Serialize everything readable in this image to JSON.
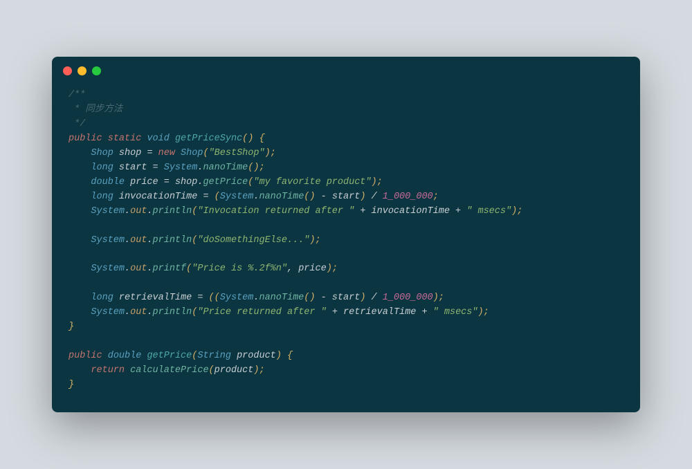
{
  "window": {
    "dots": [
      "red",
      "yellow",
      "green"
    ]
  },
  "code": {
    "lines": [
      {
        "indent": 0,
        "tokens": [
          {
            "c": "c-comment",
            "t": "/**"
          }
        ]
      },
      {
        "indent": 0,
        "tokens": [
          {
            "c": "c-comment",
            "t": " * 同步方法"
          }
        ]
      },
      {
        "indent": 0,
        "tokens": [
          {
            "c": "c-comment",
            "t": " */"
          }
        ]
      },
      {
        "indent": 0,
        "tokens": [
          {
            "c": "c-kw",
            "t": "public "
          },
          {
            "c": "c-kw",
            "t": "static "
          },
          {
            "c": "c-type",
            "t": "void "
          },
          {
            "c": "c-method",
            "t": "getPriceSync"
          },
          {
            "c": "c-paren",
            "t": "() {"
          }
        ]
      },
      {
        "indent": 1,
        "tokens": [
          {
            "c": "c-type",
            "t": "Shop "
          },
          {
            "c": "c-ident",
            "t": "shop "
          },
          {
            "c": "c-op",
            "t": "= "
          },
          {
            "c": "c-kw",
            "t": "new "
          },
          {
            "c": "c-type",
            "t": "Shop"
          },
          {
            "c": "c-paren",
            "t": "("
          },
          {
            "c": "c-string",
            "t": "\"BestShop\""
          },
          {
            "c": "c-paren",
            "t": ");"
          }
        ]
      },
      {
        "indent": 1,
        "tokens": [
          {
            "c": "c-type",
            "t": "long "
          },
          {
            "c": "c-ident",
            "t": "start "
          },
          {
            "c": "c-op",
            "t": "= "
          },
          {
            "c": "c-type",
            "t": "System"
          },
          {
            "c": "c-op",
            "t": "."
          },
          {
            "c": "c-call",
            "t": "nanoTime"
          },
          {
            "c": "c-paren",
            "t": "();"
          }
        ]
      },
      {
        "indent": 1,
        "tokens": [
          {
            "c": "c-type",
            "t": "double "
          },
          {
            "c": "c-ident",
            "t": "price "
          },
          {
            "c": "c-op",
            "t": "= "
          },
          {
            "c": "c-ident",
            "t": "shop"
          },
          {
            "c": "c-op",
            "t": "."
          },
          {
            "c": "c-call",
            "t": "getPrice"
          },
          {
            "c": "c-paren",
            "t": "("
          },
          {
            "c": "c-string",
            "t": "\"my favorite product\""
          },
          {
            "c": "c-paren",
            "t": ");"
          }
        ]
      },
      {
        "indent": 1,
        "tokens": [
          {
            "c": "c-type",
            "t": "long "
          },
          {
            "c": "c-ident",
            "t": "invocationTime "
          },
          {
            "c": "c-op",
            "t": "= "
          },
          {
            "c": "c-paren",
            "t": "("
          },
          {
            "c": "c-type",
            "t": "System"
          },
          {
            "c": "c-op",
            "t": "."
          },
          {
            "c": "c-call",
            "t": "nanoTime"
          },
          {
            "c": "c-paren",
            "t": "()"
          },
          {
            "c": "c-op",
            "t": " - "
          },
          {
            "c": "c-ident",
            "t": "start"
          },
          {
            "c": "c-paren",
            "t": ")"
          },
          {
            "c": "c-op",
            "t": " / "
          },
          {
            "c": "c-number",
            "t": "1_000_000"
          },
          {
            "c": "c-paren",
            "t": ";"
          }
        ]
      },
      {
        "indent": 1,
        "tokens": [
          {
            "c": "c-type",
            "t": "System"
          },
          {
            "c": "c-op",
            "t": "."
          },
          {
            "c": "c-field",
            "t": "out"
          },
          {
            "c": "c-op",
            "t": "."
          },
          {
            "c": "c-call",
            "t": "println"
          },
          {
            "c": "c-paren",
            "t": "("
          },
          {
            "c": "c-string",
            "t": "\"Invocation returned after \""
          },
          {
            "c": "c-op",
            "t": " + "
          },
          {
            "c": "c-ident",
            "t": "invocationTime"
          },
          {
            "c": "c-op",
            "t": " + "
          },
          {
            "c": "c-string",
            "t": "\" msecs\""
          },
          {
            "c": "c-paren",
            "t": ");"
          }
        ]
      },
      {
        "indent": 0,
        "tokens": [
          {
            "c": "c-ident",
            "t": ""
          }
        ]
      },
      {
        "indent": 1,
        "tokens": [
          {
            "c": "c-type",
            "t": "System"
          },
          {
            "c": "c-op",
            "t": "."
          },
          {
            "c": "c-field",
            "t": "out"
          },
          {
            "c": "c-op",
            "t": "."
          },
          {
            "c": "c-call",
            "t": "println"
          },
          {
            "c": "c-paren",
            "t": "("
          },
          {
            "c": "c-string",
            "t": "\"doSomethingElse...\""
          },
          {
            "c": "c-paren",
            "t": ");"
          }
        ]
      },
      {
        "indent": 0,
        "tokens": [
          {
            "c": "c-ident",
            "t": ""
          }
        ]
      },
      {
        "indent": 1,
        "tokens": [
          {
            "c": "c-type",
            "t": "System"
          },
          {
            "c": "c-op",
            "t": "."
          },
          {
            "c": "c-field",
            "t": "out"
          },
          {
            "c": "c-op",
            "t": "."
          },
          {
            "c": "c-call",
            "t": "printf"
          },
          {
            "c": "c-paren",
            "t": "("
          },
          {
            "c": "c-string",
            "t": "\"Price is %.2f%n\""
          },
          {
            "c": "c-op",
            "t": ", "
          },
          {
            "c": "c-ident",
            "t": "price"
          },
          {
            "c": "c-paren",
            "t": ");"
          }
        ]
      },
      {
        "indent": 0,
        "tokens": [
          {
            "c": "c-ident",
            "t": ""
          }
        ]
      },
      {
        "indent": 1,
        "tokens": [
          {
            "c": "c-type",
            "t": "long "
          },
          {
            "c": "c-ident",
            "t": "retrievalTime "
          },
          {
            "c": "c-op",
            "t": "= "
          },
          {
            "c": "c-paren",
            "t": "(("
          },
          {
            "c": "c-type",
            "t": "System"
          },
          {
            "c": "c-op",
            "t": "."
          },
          {
            "c": "c-call",
            "t": "nanoTime"
          },
          {
            "c": "c-paren",
            "t": "()"
          },
          {
            "c": "c-op",
            "t": " - "
          },
          {
            "c": "c-ident",
            "t": "start"
          },
          {
            "c": "c-paren",
            "t": ")"
          },
          {
            "c": "c-op",
            "t": " / "
          },
          {
            "c": "c-number",
            "t": "1_000_000"
          },
          {
            "c": "c-paren",
            "t": ");"
          }
        ]
      },
      {
        "indent": 1,
        "tokens": [
          {
            "c": "c-type",
            "t": "System"
          },
          {
            "c": "c-op",
            "t": "."
          },
          {
            "c": "c-field",
            "t": "out"
          },
          {
            "c": "c-op",
            "t": "."
          },
          {
            "c": "c-call",
            "t": "println"
          },
          {
            "c": "c-paren",
            "t": "("
          },
          {
            "c": "c-string",
            "t": "\"Price returned after \""
          },
          {
            "c": "c-op",
            "t": " + "
          },
          {
            "c": "c-ident",
            "t": "retrievalTime"
          },
          {
            "c": "c-op",
            "t": " + "
          },
          {
            "c": "c-string",
            "t": "\" msecs\""
          },
          {
            "c": "c-paren",
            "t": ");"
          }
        ]
      },
      {
        "indent": 0,
        "tokens": [
          {
            "c": "c-paren",
            "t": "}"
          }
        ]
      },
      {
        "indent": 0,
        "tokens": [
          {
            "c": "c-ident",
            "t": ""
          }
        ]
      },
      {
        "indent": 0,
        "tokens": [
          {
            "c": "c-kw",
            "t": "public "
          },
          {
            "c": "c-type",
            "t": "double "
          },
          {
            "c": "c-method",
            "t": "getPrice"
          },
          {
            "c": "c-paren",
            "t": "("
          },
          {
            "c": "c-type",
            "t": "String "
          },
          {
            "c": "c-ident",
            "t": "product"
          },
          {
            "c": "c-paren",
            "t": ") {"
          }
        ]
      },
      {
        "indent": 1,
        "tokens": [
          {
            "c": "c-kw",
            "t": "return "
          },
          {
            "c": "c-call",
            "t": "calculatePrice"
          },
          {
            "c": "c-paren",
            "t": "("
          },
          {
            "c": "c-ident",
            "t": "product"
          },
          {
            "c": "c-paren",
            "t": ");"
          }
        ]
      },
      {
        "indent": 0,
        "tokens": [
          {
            "c": "c-paren",
            "t": "}"
          }
        ]
      }
    ]
  }
}
